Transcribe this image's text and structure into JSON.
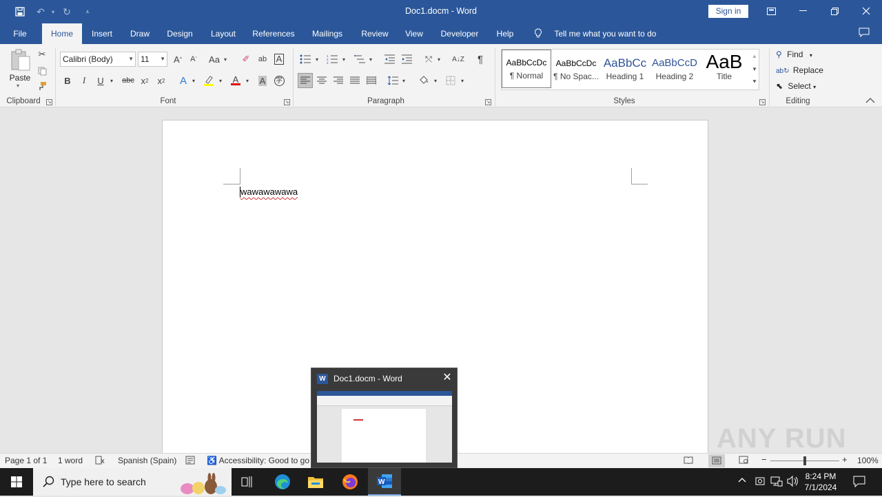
{
  "window": {
    "title": "Doc1.docm  -  Word",
    "sign_in": "Sign in"
  },
  "tabs": [
    {
      "label": "File"
    },
    {
      "label": "Home"
    },
    {
      "label": "Insert"
    },
    {
      "label": "Draw"
    },
    {
      "label": "Design"
    },
    {
      "label": "Layout"
    },
    {
      "label": "References"
    },
    {
      "label": "Mailings"
    },
    {
      "label": "Review"
    },
    {
      "label": "View"
    },
    {
      "label": "Developer"
    },
    {
      "label": "Help"
    }
  ],
  "tell_me": "Tell me what you want to do",
  "ribbon": {
    "clipboard": {
      "label": "Clipboard",
      "paste": "Paste"
    },
    "font": {
      "label": "Font",
      "font_name": "Calibri (Body)",
      "font_size": "11",
      "change_case": "Aa"
    },
    "paragraph": {
      "label": "Paragraph"
    },
    "styles": {
      "label": "Styles",
      "items": [
        {
          "preview": "AaBbCcDc",
          "name": "¶ Normal"
        },
        {
          "preview": "AaBbCcDc",
          "name": "¶ No Spac..."
        },
        {
          "preview": "AaBbCc",
          "name": "Heading 1"
        },
        {
          "preview": "AaBbCcD",
          "name": "Heading 2"
        },
        {
          "preview": "AaB",
          "name": "Title"
        }
      ]
    },
    "editing": {
      "label": "Editing",
      "find": "Find",
      "replace": "Replace",
      "select": "Select"
    }
  },
  "document": {
    "text": "wawawawawa"
  },
  "status": {
    "page": "Page 1 of 1",
    "words": "1 word",
    "language": "Spanish (Spain)",
    "accessibility": "Accessibility: Good to go",
    "zoom": "100%",
    "zoom_level": 1.0
  },
  "thumbnail": {
    "title": "Doc1.docm - Word"
  },
  "watermark": "ANY RUN",
  "taskbar": {
    "search_placeholder": "Type here to search",
    "time": "8:24 PM",
    "date": "7/1/2024"
  }
}
